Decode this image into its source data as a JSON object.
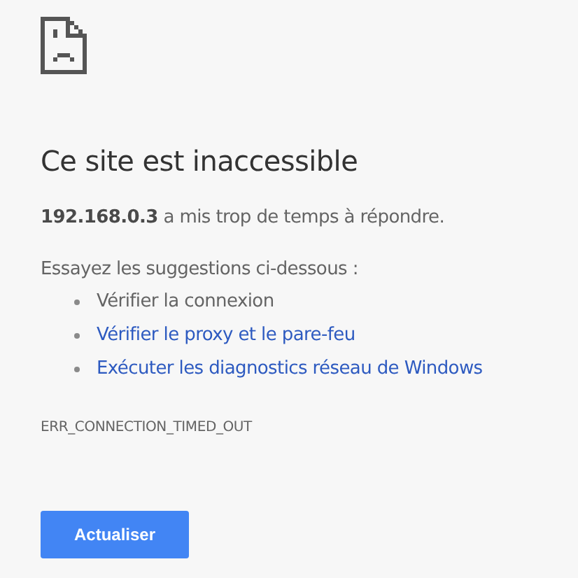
{
  "heading": "Ce site est inaccessible",
  "summary": "**192.168.0.3** a mis trop de temps à répondre.",
  "suggestions_intro": "Essayez les suggestions ci-dessous :",
  "suggestions": [
    {
      "kind": "text",
      "label": "Vérifier la connexion"
    },
    {
      "kind": "link",
      "label": "Vérifier le proxy et le pare-feu"
    },
    {
      "kind": "link",
      "label": "Exécuter les diagnostics réseau de Windows"
    }
  ],
  "error_code": "ERR_CONNECTION_TIMED_OUT",
  "buttons": [
    {
      "label": "Actualiser"
    }
  ]
}
